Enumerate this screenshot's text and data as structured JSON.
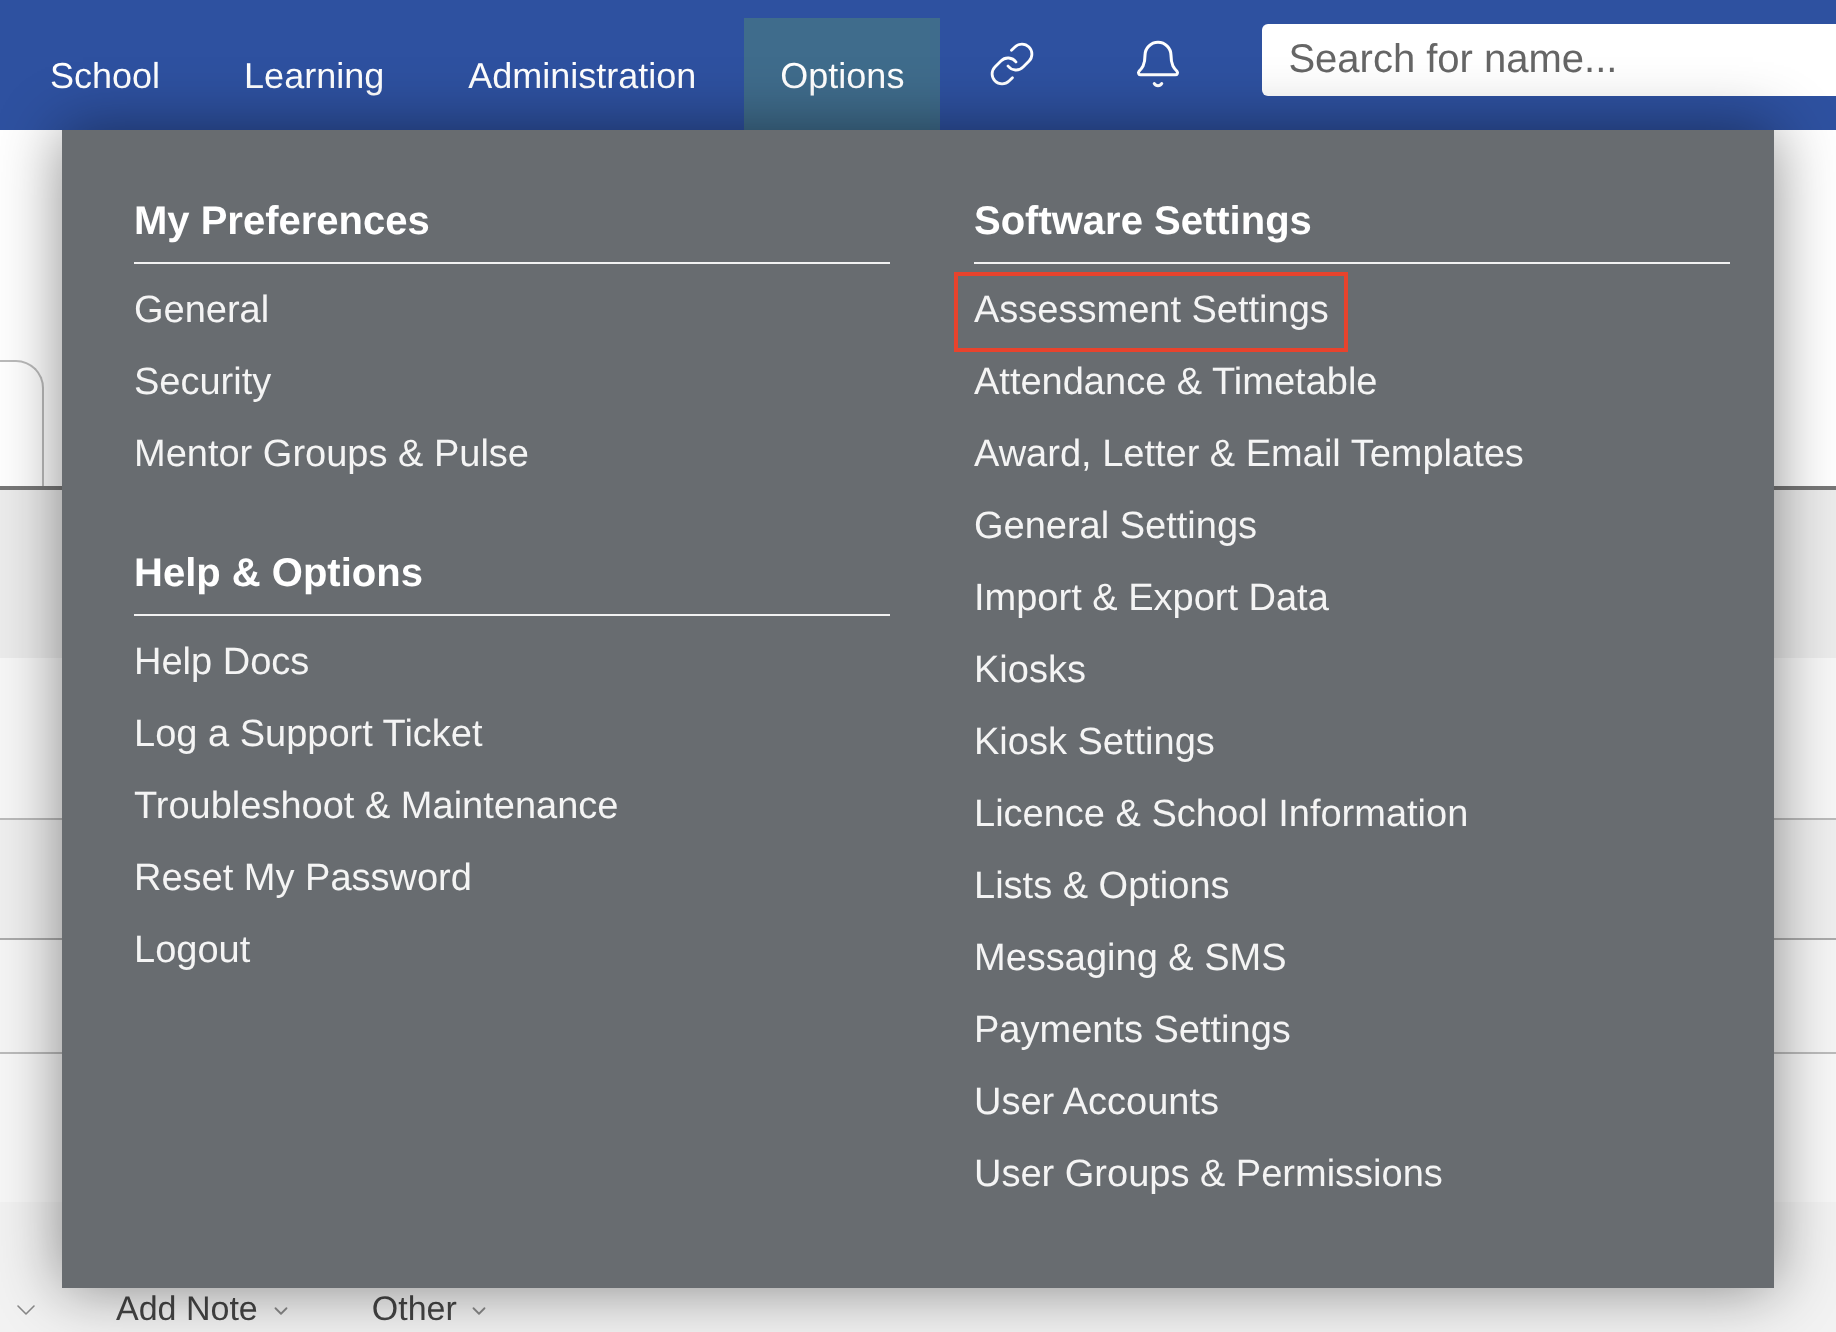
{
  "nav": {
    "items": [
      {
        "label": "School",
        "selected": false
      },
      {
        "label": "Learning",
        "selected": false
      },
      {
        "label": "Administration",
        "selected": false
      },
      {
        "label": "Options",
        "selected": true
      }
    ],
    "search": {
      "placeholder": "Search for name..."
    }
  },
  "menu": {
    "columns": [
      {
        "sections": [
          {
            "title": "My Preferences",
            "items": [
              {
                "label": "General",
                "highlighted": false
              },
              {
                "label": "Security",
                "highlighted": false
              },
              {
                "label": "Mentor Groups & Pulse",
                "highlighted": false
              }
            ]
          },
          {
            "title": "Help & Options",
            "items": [
              {
                "label": "Help Docs",
                "highlighted": false
              },
              {
                "label": "Log a Support Ticket",
                "highlighted": false
              },
              {
                "label": "Troubleshoot & Maintenance",
                "highlighted": false
              },
              {
                "label": "Reset My Password",
                "highlighted": false
              },
              {
                "label": "Logout",
                "highlighted": false
              }
            ]
          }
        ]
      },
      {
        "sections": [
          {
            "title": "Software Settings",
            "items": [
              {
                "label": "Assessment Settings",
                "highlighted": true
              },
              {
                "label": "Attendance & Timetable",
                "highlighted": false
              },
              {
                "label": "Award, Letter & Email Templates",
                "highlighted": false
              },
              {
                "label": "General Settings",
                "highlighted": false
              },
              {
                "label": "Import & Export Data",
                "highlighted": false
              },
              {
                "label": "Kiosks",
                "highlighted": false
              },
              {
                "label": "Kiosk Settings",
                "highlighted": false
              },
              {
                "label": "Licence & School Information",
                "highlighted": false
              },
              {
                "label": "Lists & Options",
                "highlighted": false
              },
              {
                "label": "Messaging & SMS",
                "highlighted": false
              },
              {
                "label": "Payments Settings",
                "highlighted": false
              },
              {
                "label": "User Accounts",
                "highlighted": false
              },
              {
                "label": "User Groups & Permissions",
                "highlighted": false
              }
            ]
          }
        ]
      }
    ]
  },
  "toolbar": {
    "items": [
      "Add Note",
      "Other"
    ]
  }
}
